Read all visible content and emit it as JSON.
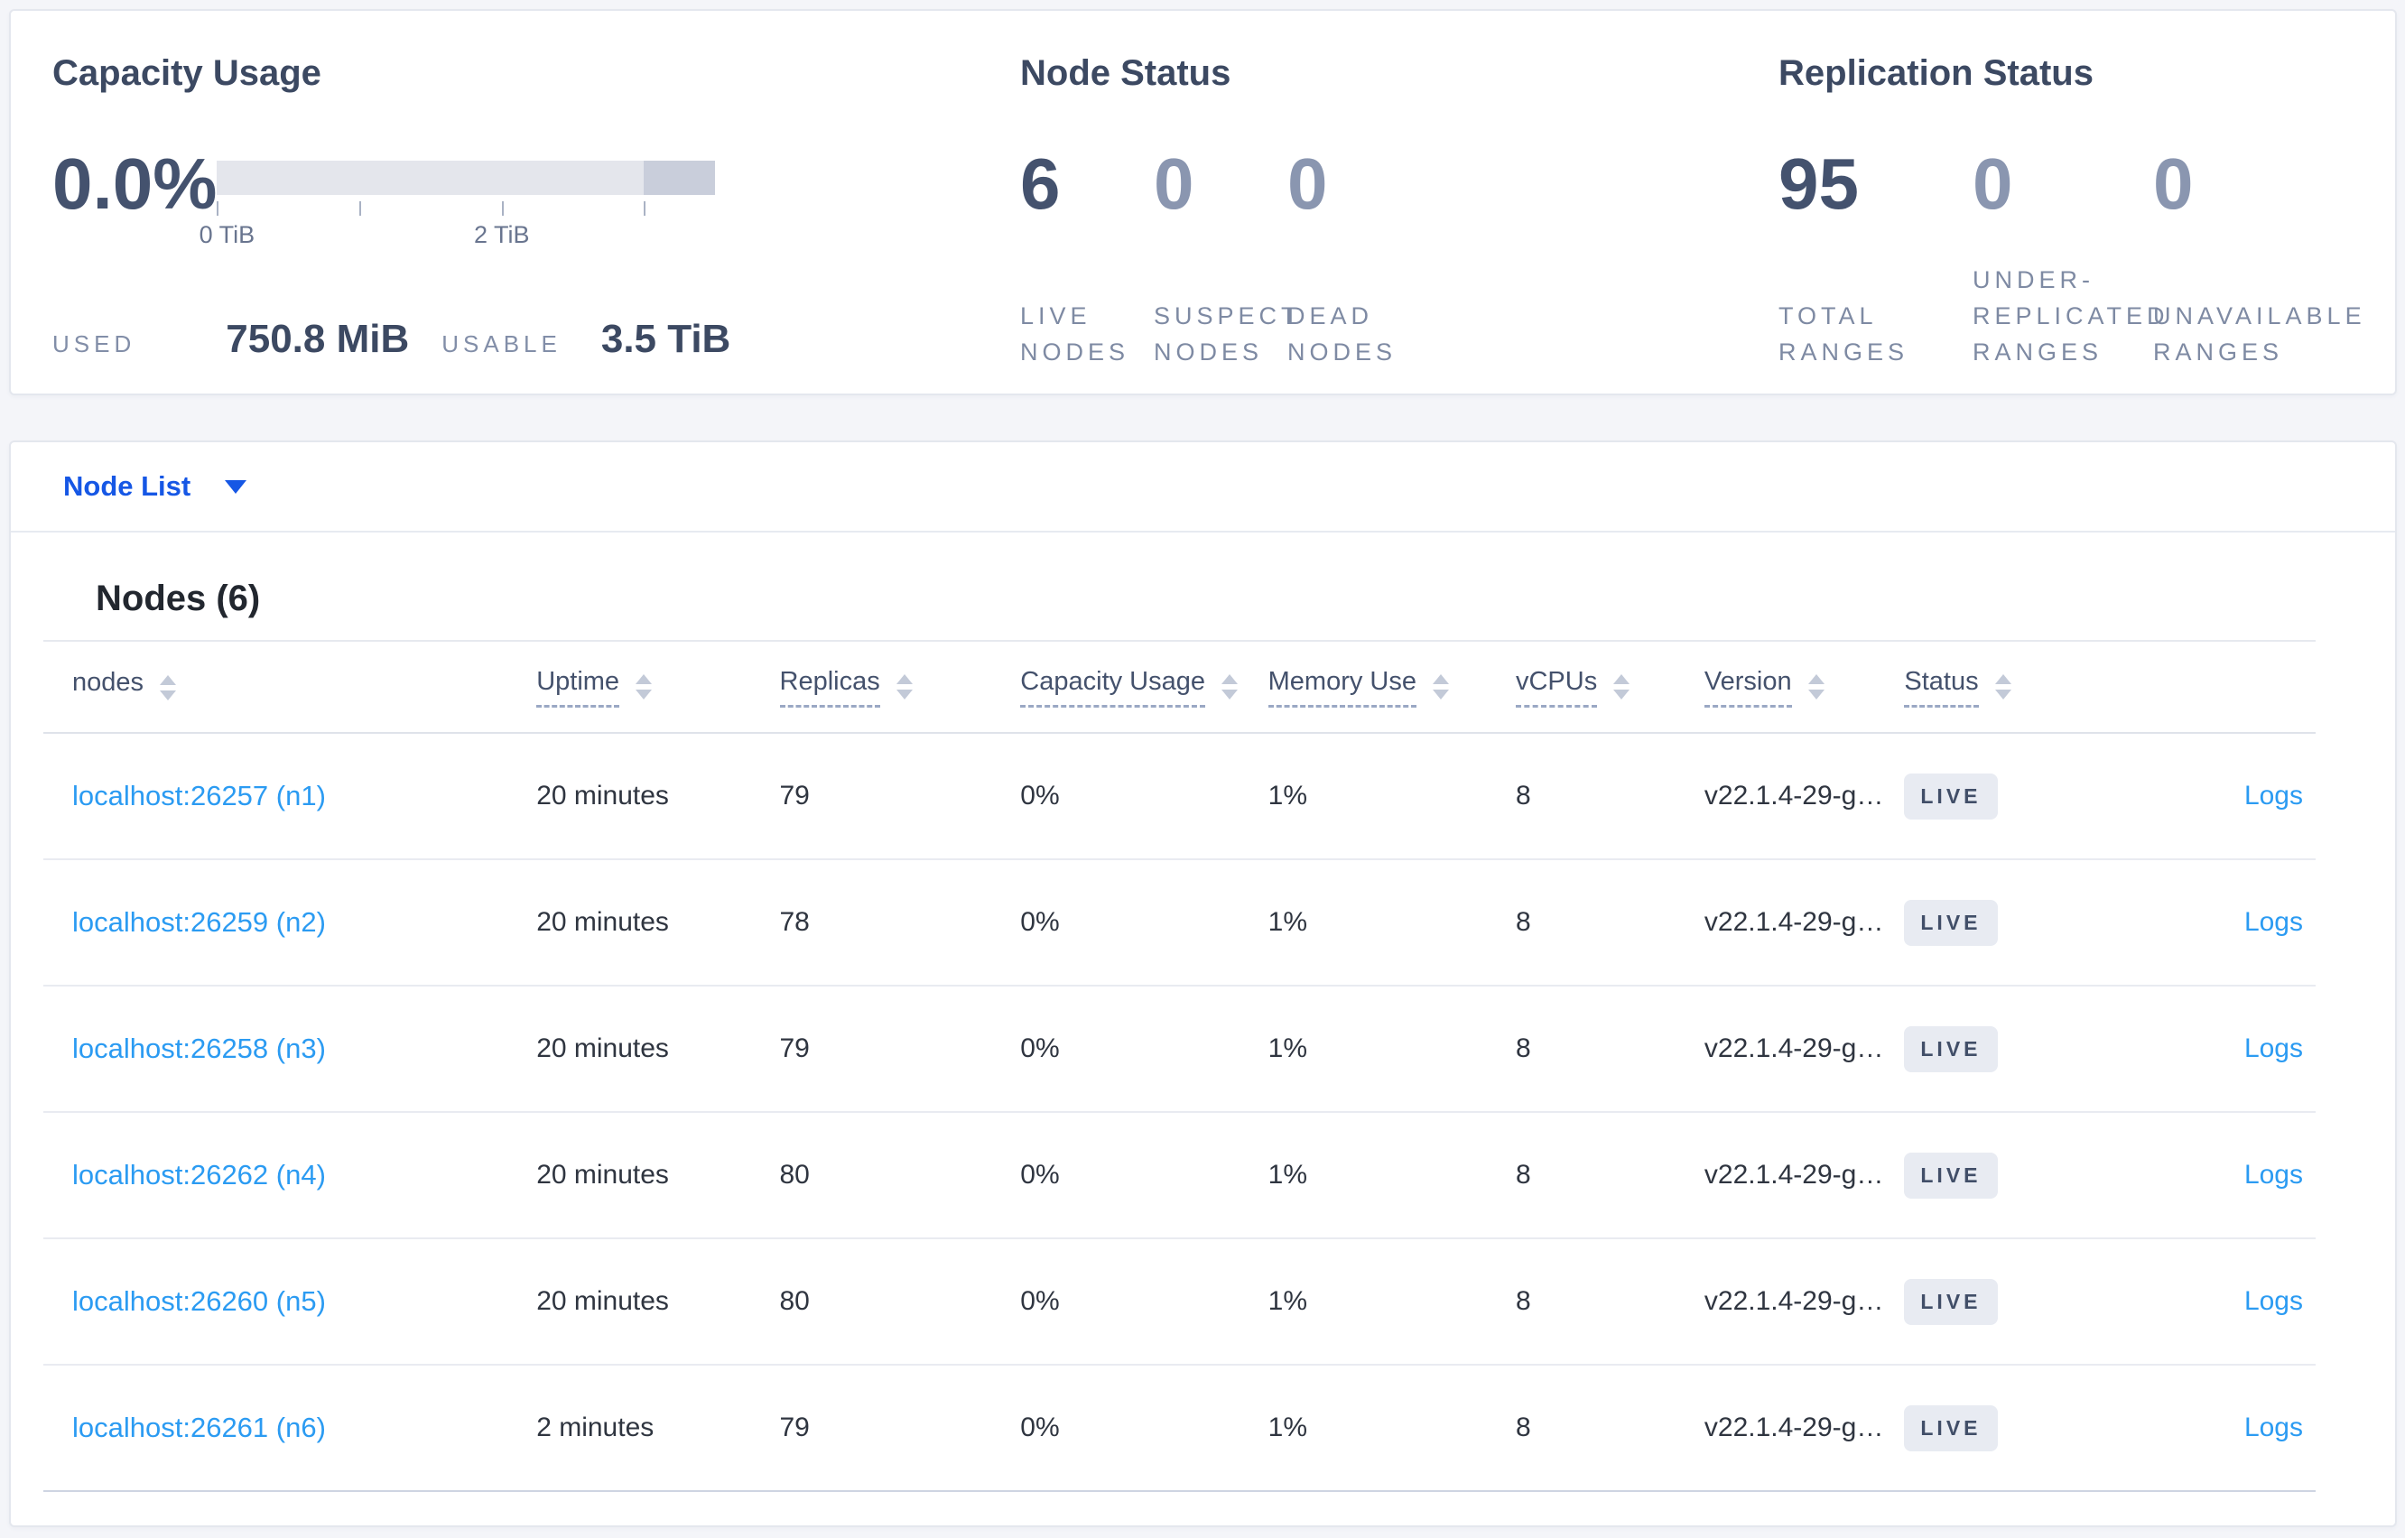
{
  "colors": {
    "page_background": "#f4f5f9",
    "card_background": "#ffffff",
    "selector_blue": "#1657e5",
    "link_blue": "#2b9bf2",
    "heading_slate": "#3c4962",
    "big_number": "#44526e",
    "muted_number": "#8a96b0",
    "caps_label": "#7e8aa3",
    "badge_background": "#e8ebf2",
    "bar_track": "#e4e6ec",
    "bar_dark_segment": "#c9cedb"
  },
  "icons": {
    "node_list_dropdown": "caret-down-icon",
    "column_sort": "sort-arrows-icon"
  },
  "summary": {
    "capacity": {
      "title": "Capacity Usage",
      "percent": "0.0%",
      "bar": {
        "total_tib": 3.5,
        "dark_segment_start_tib": 3.0,
        "tick_interval_tib": 1
      },
      "tick_labels": [
        "0 TiB",
        "2 TiB"
      ],
      "used_label": "USED",
      "used_value": "750.8 MiB",
      "usable_label": "USABLE",
      "usable_value": "3.5 TiB"
    },
    "node_status": {
      "title": "Node Status",
      "stats": [
        {
          "value": "6",
          "label": "LIVE\nNODES",
          "muted": false
        },
        {
          "value": "0",
          "label": "SUSPECT\nNODES",
          "muted": true
        },
        {
          "value": "0",
          "label": "DEAD\nNODES",
          "muted": true
        }
      ]
    },
    "replication": {
      "title": "Replication Status",
      "stats": [
        {
          "value": "95",
          "label": "TOTAL\nRANGES",
          "muted": false
        },
        {
          "value": "0",
          "label": "UNDER-\nREPLICATED\nRANGES",
          "muted": true
        },
        {
          "value": "0",
          "label": "UNAVAILABLE\nRANGES",
          "muted": true
        }
      ]
    }
  },
  "node_list": {
    "selector_label": "Node List"
  },
  "table": {
    "heading": "Nodes (6)",
    "columns": [
      {
        "label": "nodes",
        "sortable": true,
        "dashed": false
      },
      {
        "label": "Uptime",
        "sortable": true,
        "dashed": true
      },
      {
        "label": "Replicas",
        "sortable": true,
        "dashed": true
      },
      {
        "label": "Capacity Usage",
        "sortable": true,
        "dashed": true
      },
      {
        "label": "Memory Use",
        "sortable": true,
        "dashed": true
      },
      {
        "label": "vCPUs",
        "sortable": true,
        "dashed": true
      },
      {
        "label": "Version",
        "sortable": true,
        "dashed": true
      },
      {
        "label": "Status",
        "sortable": true,
        "dashed": true
      },
      {
        "label": "",
        "sortable": false,
        "dashed": false
      }
    ],
    "rows": [
      {
        "node": "localhost:26257 (n1)",
        "uptime": "20 minutes",
        "replicas": "79",
        "capacity": "0%",
        "memory": "1%",
        "vcpus": "8",
        "version": "v22.1.4-29-g…",
        "status": "LIVE",
        "logs": "Logs"
      },
      {
        "node": "localhost:26259 (n2)",
        "uptime": "20 minutes",
        "replicas": "78",
        "capacity": "0%",
        "memory": "1%",
        "vcpus": "8",
        "version": "v22.1.4-29-g…",
        "status": "LIVE",
        "logs": "Logs"
      },
      {
        "node": "localhost:26258 (n3)",
        "uptime": "20 minutes",
        "replicas": "79",
        "capacity": "0%",
        "memory": "1%",
        "vcpus": "8",
        "version": "v22.1.4-29-g…",
        "status": "LIVE",
        "logs": "Logs"
      },
      {
        "node": "localhost:26262 (n4)",
        "uptime": "20 minutes",
        "replicas": "80",
        "capacity": "0%",
        "memory": "1%",
        "vcpus": "8",
        "version": "v22.1.4-29-g…",
        "status": "LIVE",
        "logs": "Logs"
      },
      {
        "node": "localhost:26260 (n5)",
        "uptime": "20 minutes",
        "replicas": "80",
        "capacity": "0%",
        "memory": "1%",
        "vcpus": "8",
        "version": "v22.1.4-29-g…",
        "status": "LIVE",
        "logs": "Logs"
      },
      {
        "node": "localhost:26261 (n6)",
        "uptime": "2 minutes",
        "replicas": "79",
        "capacity": "0%",
        "memory": "1%",
        "vcpus": "8",
        "version": "v22.1.4-29-g…",
        "status": "LIVE",
        "logs": "Logs"
      }
    ]
  }
}
